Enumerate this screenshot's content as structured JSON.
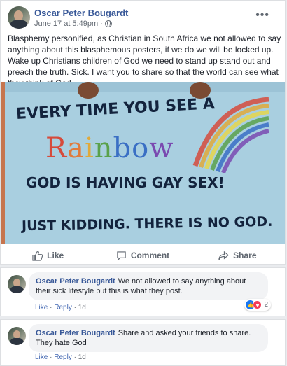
{
  "post": {
    "author": "Oscar Peter Bougardt",
    "date": "June 17 at 5:49pm",
    "separator": "·",
    "more": "•••",
    "text": "Blasphemy personified, as Christian in South Africa we not allowed to say anything about this blasphemous posters, if we do we will be locked up. Wake up Christians children of God we need to stand up stand out and preach the truth. Sick. I want you to share so that the world can see what they think of God",
    "image": {
      "line1": "EVERY TIME YOU SEE A",
      "rainbow_letters": [
        "R",
        "a",
        "i",
        "n",
        "b",
        "o",
        "w"
      ],
      "rainbow_colors": [
        "#d64b3c",
        "#e07a3a",
        "#e0a93a",
        "#5aa14b",
        "#3a6fc4",
        "#3a6fc4",
        "#7a4ab0"
      ],
      "line3": "GOD IS HAVING GAY SEX!",
      "line4": "JUST KIDDING. THERE IS NO GOD."
    },
    "actions": {
      "like": "Like",
      "comment": "Comment",
      "share": "Share"
    }
  },
  "comments": [
    {
      "author": "Oscar Peter Bougardt",
      "text": "We not allowed to say anything about their sick lifestyle but this is what they post.",
      "like": "Like",
      "reply": "Reply",
      "time": "1d",
      "reaction_count": "2"
    },
    {
      "author": "Oscar Peter Bougardt",
      "text": "Share and asked your friends to share. They hate God",
      "like": "Like",
      "reply": "Reply",
      "time": "1d"
    }
  ],
  "colors": {
    "link": "#385898",
    "accent": "#4267b2",
    "secondary_text": "#606770"
  }
}
